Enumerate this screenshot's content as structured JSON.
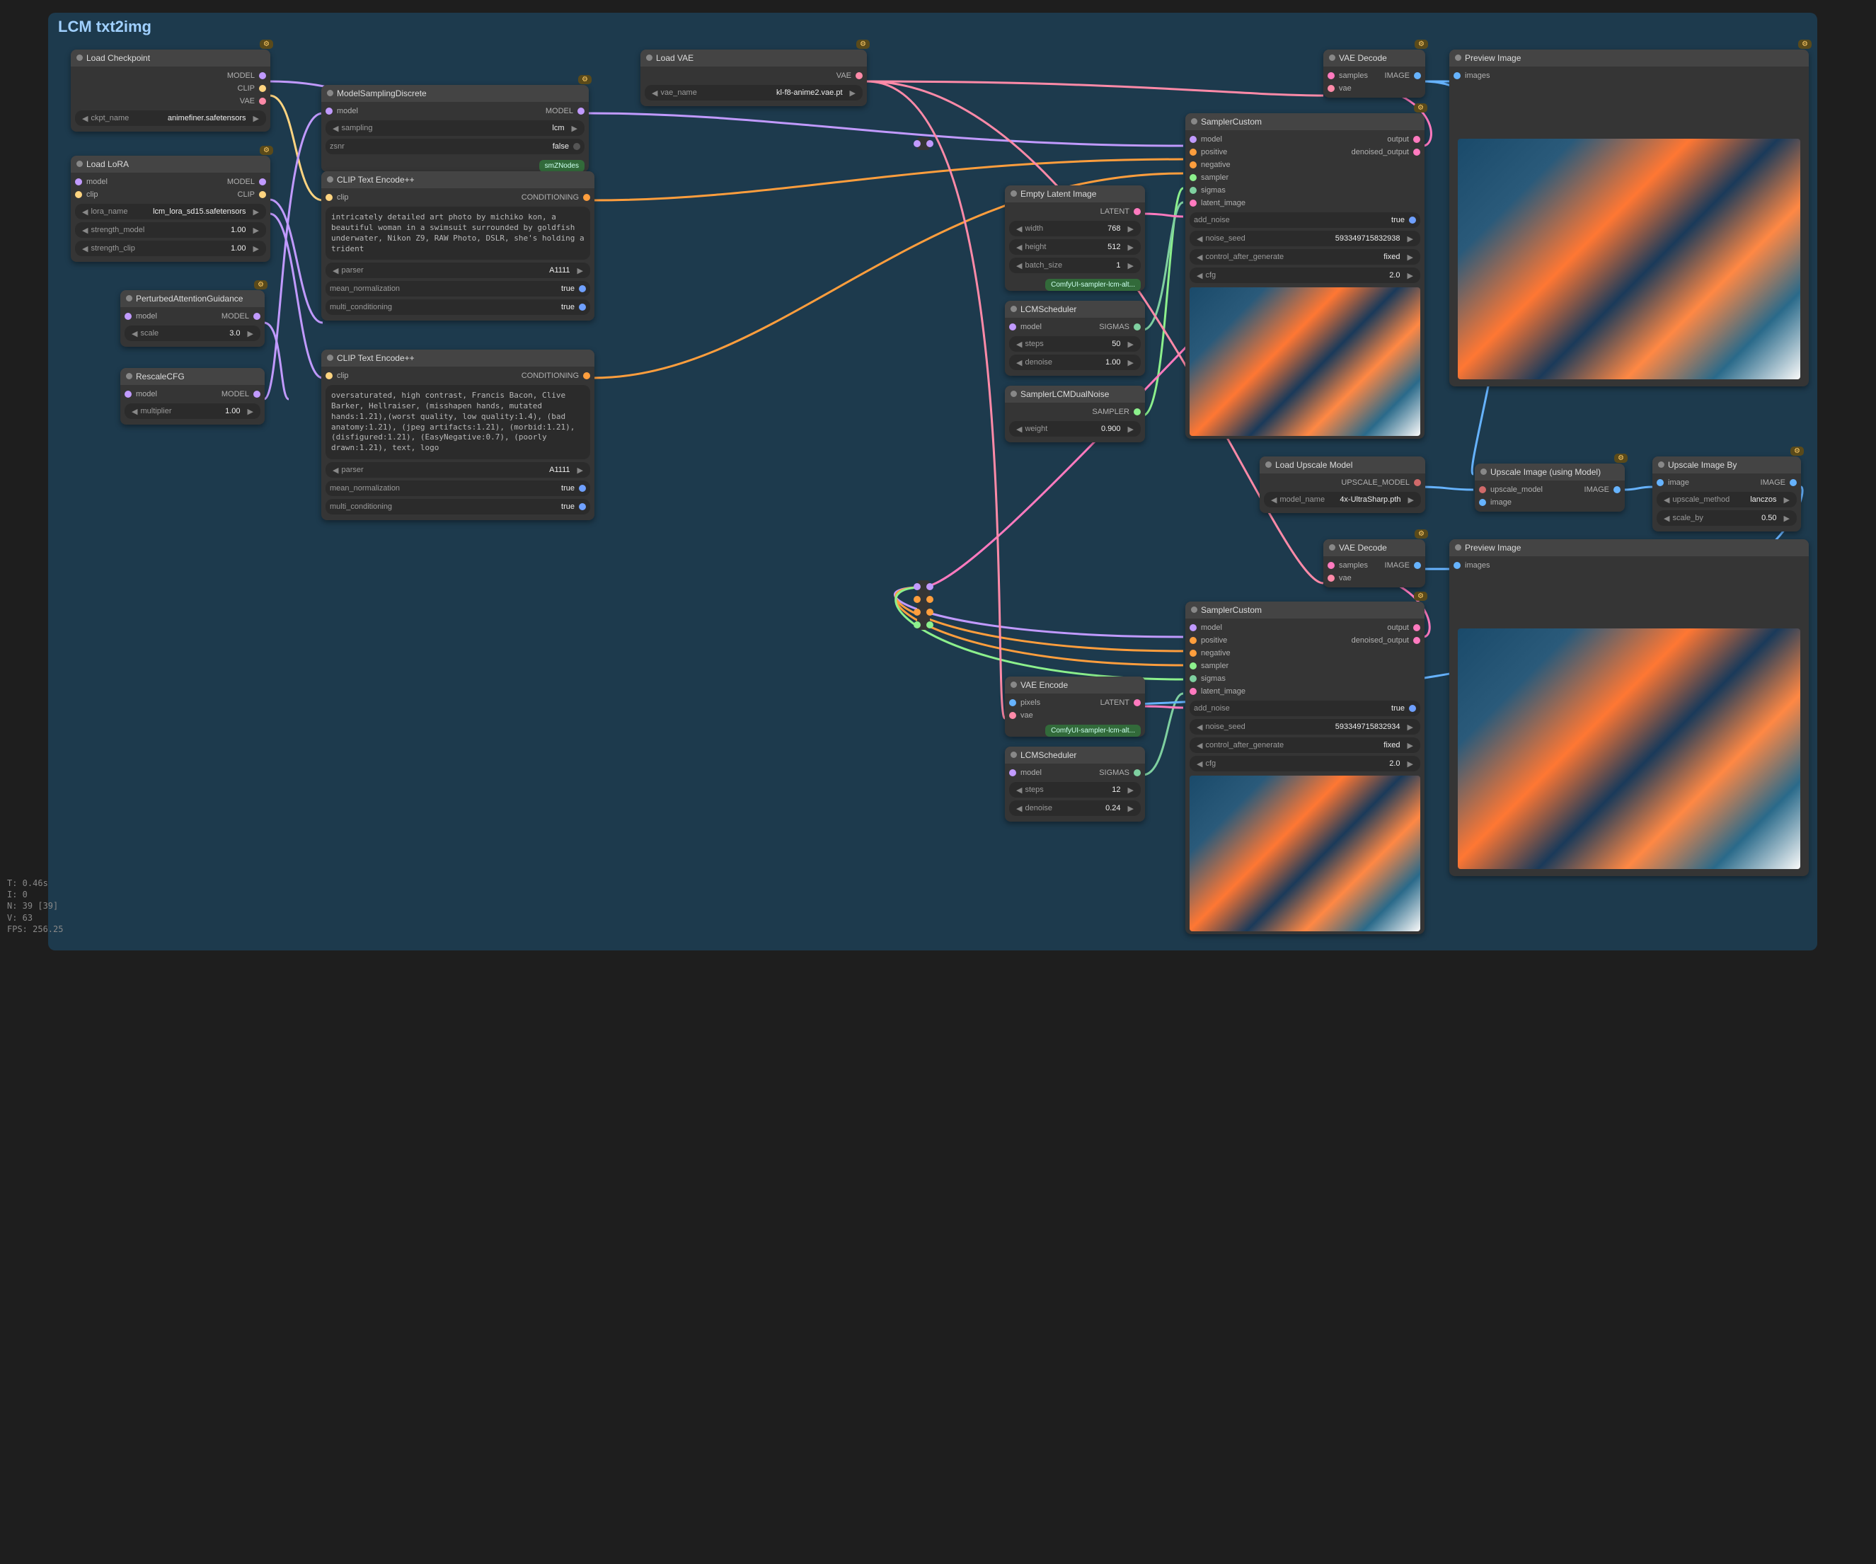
{
  "group": {
    "title": "LCM txt2img"
  },
  "stats": {
    "l1": "T: 0.46s",
    "l2": "I: 0",
    "l3": "N: 39 [39]",
    "l4": "V: 63",
    "l5": "FPS: 256.25"
  },
  "load_ckpt": {
    "title": "Load Checkpoint",
    "out_model": "MODEL",
    "out_clip": "CLIP",
    "out_vae": "VAE",
    "ckpt_label": "ckpt_name",
    "ckpt_val": "animefiner.safetensors"
  },
  "load_lora": {
    "title": "Load LoRA",
    "in_model": "model",
    "in_clip": "clip",
    "out_model": "MODEL",
    "out_clip": "CLIP",
    "lora_label": "lora_name",
    "lora_val": "lcm_lora_sd15.safetensors",
    "sm_label": "strength_model",
    "sm_val": "1.00",
    "sc_label": "strength_clip",
    "sc_val": "1.00"
  },
  "pert": {
    "title": "PerturbedAttentionGuidance",
    "in_model": "model",
    "out_model": "MODEL",
    "scale_label": "scale",
    "scale_val": "3.0"
  },
  "rescale": {
    "title": "RescaleCFG",
    "in_model": "model",
    "out_model": "MODEL",
    "mul_label": "multiplier",
    "mul_val": "1.00"
  },
  "msd": {
    "title": "ModelSamplingDiscrete",
    "in_model": "model",
    "out_model": "MODEL",
    "samp_label": "sampling",
    "samp_val": "lcm",
    "zsnr_label": "zsnr",
    "zsnr_val": "false",
    "tag": "smZNodes"
  },
  "clip_pos": {
    "title": "CLIP Text Encode++",
    "in_clip": "clip",
    "out": "CONDITIONING",
    "text": "intricately detailed art photo by michiko kon, a beautiful woman in a swimsuit surrounded by goldfish underwater, Nikon Z9, RAW Photo, DSLR, she's holding a trident",
    "parser_label": "parser",
    "parser_val": "A1111",
    "mn_label": "mean_normalization",
    "mn_val": "true",
    "mc_label": "multi_conditioning",
    "mc_val": "true"
  },
  "clip_neg": {
    "title": "CLIP Text Encode++",
    "in_clip": "clip",
    "out": "CONDITIONING",
    "text": "oversaturated, high contrast, Francis Bacon, Clive Barker, Hellraiser, (misshapen hands, mutated hands:1.21),(worst quality, low quality:1.4), (bad anatomy:1.21), (jpeg artifacts:1.21), (morbid:1.21), (disfigured:1.21), (EasyNegative:0.7), (poorly drawn:1.21), text, logo",
    "parser_label": "parser",
    "parser_val": "A1111",
    "mn_label": "mean_normalization",
    "mn_val": "true",
    "mc_label": "multi_conditioning",
    "mc_val": "true"
  },
  "load_vae": {
    "title": "Load VAE",
    "out": "VAE",
    "vn_label": "vae_name",
    "vn_val": "kl-f8-anime2.vae.pt"
  },
  "empty_lat": {
    "title": "Empty Latent Image",
    "out": "LATENT",
    "w_label": "width",
    "w_val": "768",
    "h_label": "height",
    "h_val": "512",
    "b_label": "batch_size",
    "b_val": "1",
    "badge": "ComfyUI-sampler-lcm-alt..."
  },
  "lcm_sched1": {
    "title": "LCMScheduler",
    "in_model": "model",
    "out": "SIGMAS",
    "s_label": "steps",
    "s_val": "50",
    "d_label": "denoise",
    "d_val": "1.00"
  },
  "samp_dual": {
    "title": "SamplerLCMDualNoise",
    "out": "SAMPLER",
    "w_label": "weight",
    "w_val": "0.900"
  },
  "samp_cust1": {
    "title": "SamplerCustom",
    "in_model": "model",
    "in_pos": "positive",
    "in_neg": "negative",
    "in_samp": "sampler",
    "in_sig": "sigmas",
    "in_lat": "latent_image",
    "out_o": "output",
    "out_d": "denoised_output",
    "an_label": "add_noise",
    "an_val": "true",
    "ns_label": "noise_seed",
    "ns_val": "593349715832938",
    "cg_label": "control_after_generate",
    "cg_val": "fixed",
    "cfg_label": "cfg",
    "cfg_val": "2.0"
  },
  "vae_dec1": {
    "title": "VAE Decode",
    "in_s": "samples",
    "in_v": "vae",
    "out": "IMAGE"
  },
  "preview1": {
    "title": "Preview Image",
    "in": "images"
  },
  "load_up": {
    "title": "Load Upscale Model",
    "out": "UPSCALE_MODEL",
    "mn_label": "model_name",
    "mn_val": "4x-UltraSharp.pth"
  },
  "up_model": {
    "title": "Upscale Image (using Model)",
    "in_m": "upscale_model",
    "in_i": "image",
    "out": "IMAGE"
  },
  "up_by": {
    "title": "Upscale Image By",
    "in": "image",
    "out": "IMAGE",
    "um_label": "upscale_method",
    "um_val": "lanczos",
    "sb_label": "scale_by",
    "sb_val": "0.50"
  },
  "vae_enc": {
    "title": "VAE Encode",
    "in_p": "pixels",
    "in_v": "vae",
    "out": "LATENT",
    "badge": "ComfyUI-sampler-lcm-alt..."
  },
  "lcm_sched2": {
    "title": "LCMScheduler",
    "in_model": "model",
    "out": "SIGMAS",
    "s_label": "steps",
    "s_val": "12",
    "d_label": "denoise",
    "d_val": "0.24"
  },
  "samp_cust2": {
    "title": "SamplerCustom",
    "in_model": "model",
    "in_pos": "positive",
    "in_neg": "negative",
    "in_samp": "sampler",
    "in_sig": "sigmas",
    "in_lat": "latent_image",
    "out_o": "output",
    "out_d": "denoised_output",
    "an_label": "add_noise",
    "an_val": "true",
    "ns_label": "noise_seed",
    "ns_val": "593349715832934",
    "cg_label": "control_after_generate",
    "cg_val": "fixed",
    "cfg_label": "cfg",
    "cfg_val": "2.0"
  },
  "vae_dec2": {
    "title": "VAE Decode",
    "in_s": "samples",
    "in_v": "vae",
    "out": "IMAGE"
  },
  "preview2": {
    "title": "Preview Image",
    "in": "images"
  }
}
